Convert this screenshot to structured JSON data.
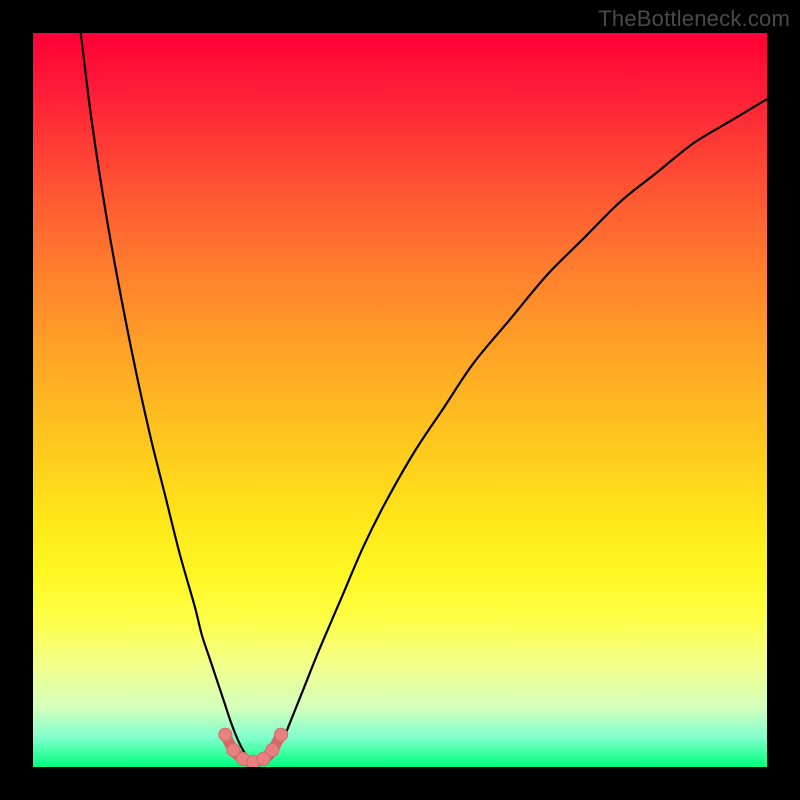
{
  "watermark": "TheBottleneck.com",
  "colors": {
    "frame": "#000000",
    "curve_stroke": "#000000",
    "marker_fill": "#e98080",
    "marker_stroke": "#d46a6a",
    "gradient_stops": [
      "#ff0036",
      "#ff1d37",
      "#ff4f33",
      "#ff7d2e",
      "#ffa526",
      "#ffc81e",
      "#ffe619",
      "#fff824",
      "#fdff48",
      "#f2ff8a",
      "#d3ffbe",
      "#7fffcb",
      "#00ff7c"
    ]
  },
  "chart_data": {
    "type": "line",
    "title": "",
    "xlabel": "",
    "ylabel": "",
    "xlim": [
      0,
      100
    ],
    "ylim": [
      0,
      100
    ],
    "series": [
      {
        "name": "bottleneck-curve",
        "x": [
          6.5,
          8,
          10,
          12,
          14,
          16,
          18,
          20,
          22,
          23,
          24,
          25,
          26,
          27,
          28,
          29,
          30,
          31,
          32,
          33,
          34,
          35,
          37,
          39,
          42,
          45,
          48,
          52,
          56,
          60,
          65,
          70,
          75,
          80,
          85,
          90,
          95,
          100
        ],
        "values": [
          100,
          88,
          75,
          64,
          54,
          45,
          37,
          29,
          22,
          18,
          15,
          12,
          9,
          6,
          3.5,
          1.7,
          0.8,
          0.6,
          0.8,
          1.8,
          3.6,
          6,
          11,
          16,
          23,
          30,
          36,
          43,
          49,
          55,
          61,
          67,
          72,
          77,
          81,
          85,
          88,
          91
        ]
      }
    ],
    "markers": {
      "name": "highlight-dots",
      "x": [
        26.2,
        27.3,
        28.6,
        30.0,
        31.4,
        32.6,
        33.8
      ],
      "values": [
        4.4,
        2.3,
        1.1,
        0.7,
        1.1,
        2.3,
        4.4
      ]
    },
    "minimum_x": 30
  }
}
